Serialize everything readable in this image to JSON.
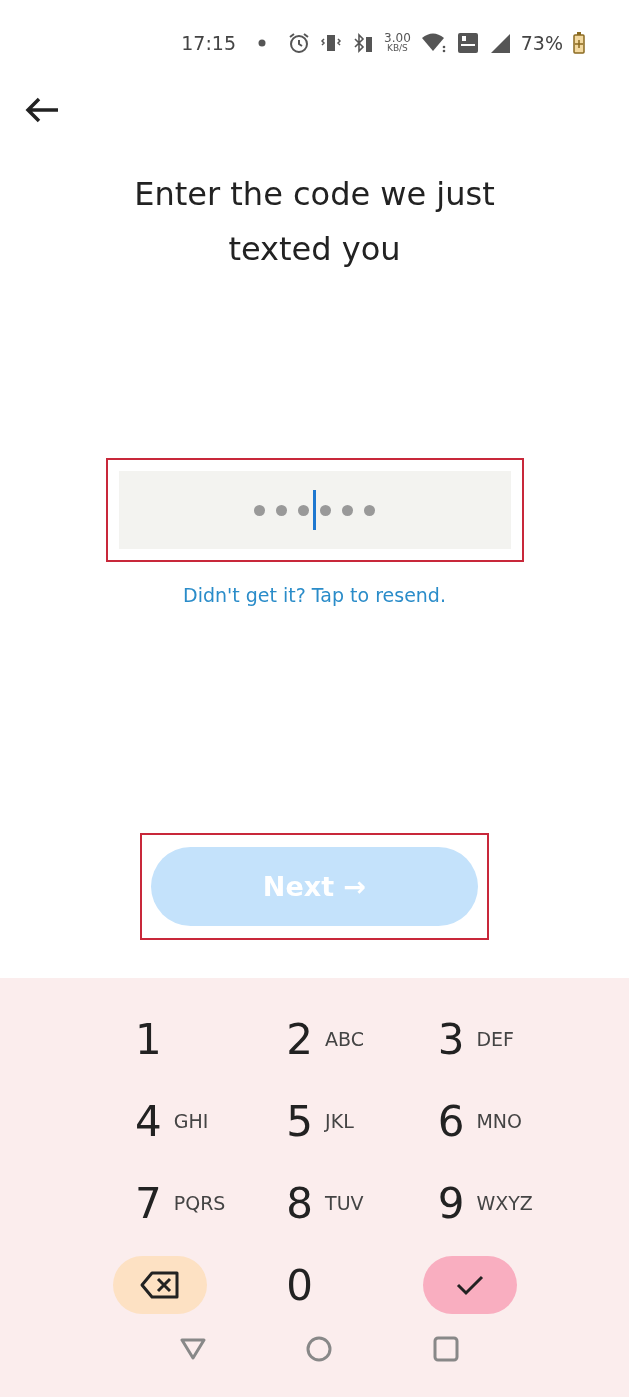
{
  "status_bar": {
    "time": "17:15",
    "speed_value": "3.00",
    "speed_unit": "KB/S",
    "battery": "73%"
  },
  "title": "Enter the code we just texted you",
  "code_field": {
    "highlighted": true,
    "slots": [
      {
        "cursor": false
      },
      {
        "cursor": false
      },
      {
        "cursor": false
      },
      {
        "cursor": true
      },
      {
        "cursor": false
      },
      {
        "cursor": false
      }
    ]
  },
  "resend_link": "Didn't get it? Tap to resend.",
  "next_button": {
    "label": "Next →",
    "disabled": true,
    "highlighted": true
  },
  "keypad": [
    {
      "kind": "digit",
      "digit": "1"
    },
    {
      "kind": "digit",
      "digit": "2",
      "letters": "ABC"
    },
    {
      "kind": "digit",
      "digit": "3",
      "letters": "DEF"
    },
    {
      "kind": "digit",
      "digit": "4",
      "letters": "GHI"
    },
    {
      "kind": "digit",
      "digit": "5",
      "letters": "JKL"
    },
    {
      "kind": "digit",
      "digit": "6",
      "letters": "MNO"
    },
    {
      "kind": "digit",
      "digit": "7",
      "letters": "PQRS"
    },
    {
      "kind": "digit",
      "digit": "8",
      "letters": "TUV"
    },
    {
      "kind": "digit",
      "digit": "9",
      "letters": "WXYZ"
    },
    {
      "kind": "backspace"
    },
    {
      "kind": "digit",
      "digit": "0"
    },
    {
      "kind": "done"
    }
  ]
}
